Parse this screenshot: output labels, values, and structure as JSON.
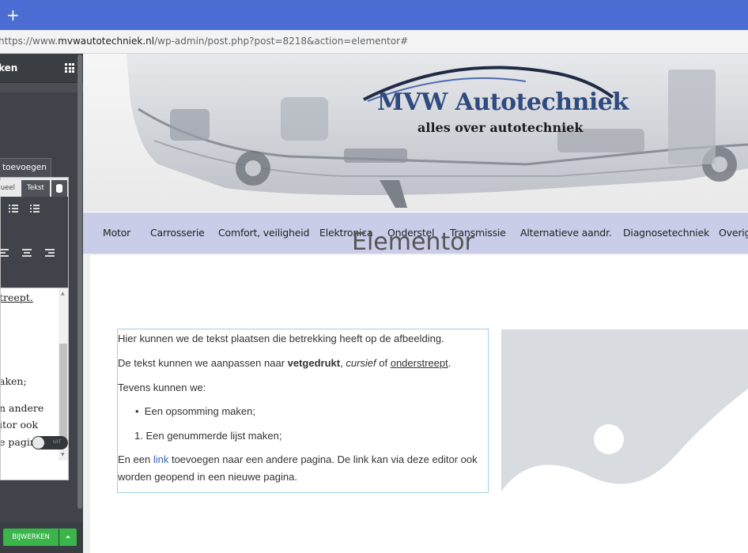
{
  "browser": {
    "new_tab_label": "+",
    "url_scheme": "https://www.",
    "url_host": "mvwautotechniek.nl",
    "url_path": "/wp-admin/post.php?post=8218&action=elementor#"
  },
  "panel": {
    "title": "ken",
    "add_media_label": "toevoegen",
    "tab_visual": "ueel",
    "tab_text": "Tekst",
    "editor_lines": [
      "treept.",
      "aken;",
      "n andere",
      "itor ook",
      "e pagina."
    ],
    "toggle_label": "UIT",
    "update_label": "BIJWERKEN"
  },
  "site": {
    "logo_title": "MVW Autotechniek",
    "logo_subtitle": "alles over autotechniek",
    "nav": [
      "Motor",
      "Carrosserie",
      "Comfort, veiligheid",
      "Elektronica",
      "Onderstel",
      "Transmissie",
      "Alternatieve aandr.",
      "Diagnosetechniek",
      "Overig"
    ],
    "page_title": "Elementor",
    "text_editor": {
      "p1": "Hier kunnen we de tekst plaatsen die betrekking heeft op de afbeelding.",
      "p2_pre": "De tekst kunnen we aanpassen naar ",
      "p2_bold": "vetgedrukt",
      "p2_sep": ", ",
      "p2_italic": "cursief",
      "p2_of": " of ",
      "p2_underline": "onderstreept",
      "p2_end": ".",
      "p3": "Tevens kunnen we:",
      "bullet": "Een opsomming maken;",
      "numbered_marker": "1.",
      "numbered": "Een genummerde lijst maken;",
      "p4_pre": "En een ",
      "p4_link": "link",
      "p4_post": " toevoegen naar een andere pagina. De link kan via deze editor ook",
      "p4_line2": "worden geopend in een nieuwe pagina."
    }
  },
  "colors": {
    "chrome_blue": "#4a6cd3",
    "nav_bg": "#c9cde8",
    "update_green": "#39b54a",
    "link": "#3a63b8"
  }
}
